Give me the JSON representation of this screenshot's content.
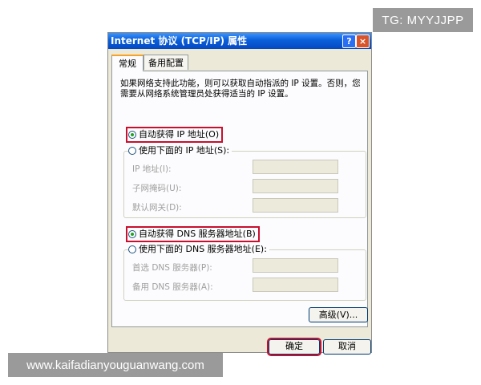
{
  "watermarks": {
    "tg": "TG: MYYJJPP",
    "url": "www.kaifadianyouguanwang.com"
  },
  "dialog": {
    "title": "Internet 协议 (TCP/IP) 属性",
    "help_label": "?",
    "close_label": "×",
    "tabs": [
      {
        "label": "常规",
        "active": true
      },
      {
        "label": "备用配置",
        "active": false
      }
    ],
    "description": "如果网络支持此功能，则可以获取自动指派的 IP 设置。否则，您需要从网络系统管理员处获得适当的 IP 设置。",
    "ip": {
      "auto_label": "自动获得 IP 地址(O)",
      "manual_label": "使用下面的 IP 地址(S):",
      "auto_selected": true,
      "fields": [
        {
          "label": "IP 地址(I):",
          "value": ""
        },
        {
          "label": "子网掩码(U):",
          "value": ""
        },
        {
          "label": "默认网关(D):",
          "value": ""
        }
      ]
    },
    "dns": {
      "auto_label": "自动获得 DNS 服务器地址(B)",
      "manual_label": "使用下面的 DNS 服务器地址(E):",
      "auto_selected": true,
      "fields": [
        {
          "label": "首选 DNS 服务器(P):",
          "value": ""
        },
        {
          "label": "备用 DNS 服务器(A):",
          "value": ""
        }
      ]
    },
    "advanced_label": "高级(V)...",
    "ok_label": "确定",
    "cancel_label": "取消",
    "highlight_color": "#c8102e"
  }
}
